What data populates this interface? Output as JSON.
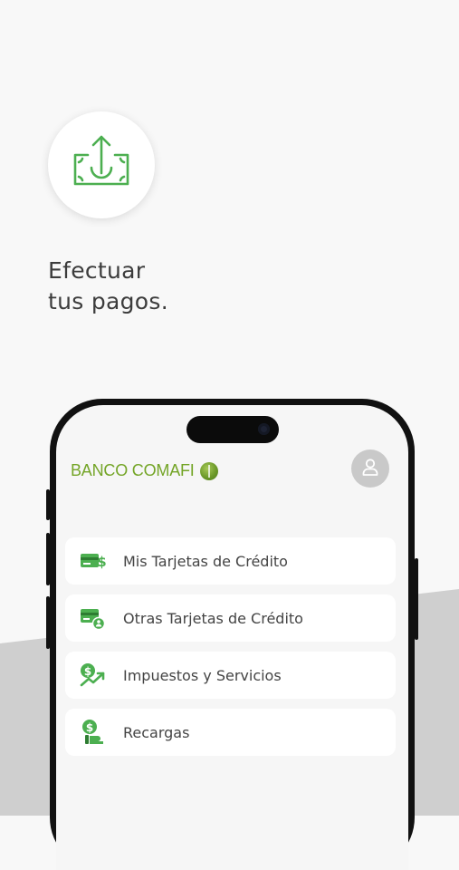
{
  "headline": {
    "line1": "Efectuar",
    "line2": "tus pagos."
  },
  "colors": {
    "accent_green": "#4caf50",
    "brand_green": "#74a527",
    "band_gray": "#cfcfcf"
  },
  "phone": {
    "brand": {
      "name": "BANCO COMAFI",
      "logo_icon": "comafi-globe-logo"
    },
    "profile_icon": "user-icon",
    "menu": [
      {
        "label": "Mis Tarjetas de Crédito",
        "icon": "credit-card-dollar-icon"
      },
      {
        "label": "Otras Tarjetas de Crédito",
        "icon": "credit-card-user-icon"
      },
      {
        "label": "Impuestos y Servicios",
        "icon": "dollar-trend-icon"
      },
      {
        "label": "Recargas",
        "icon": "dollar-hand-icon"
      }
    ]
  }
}
